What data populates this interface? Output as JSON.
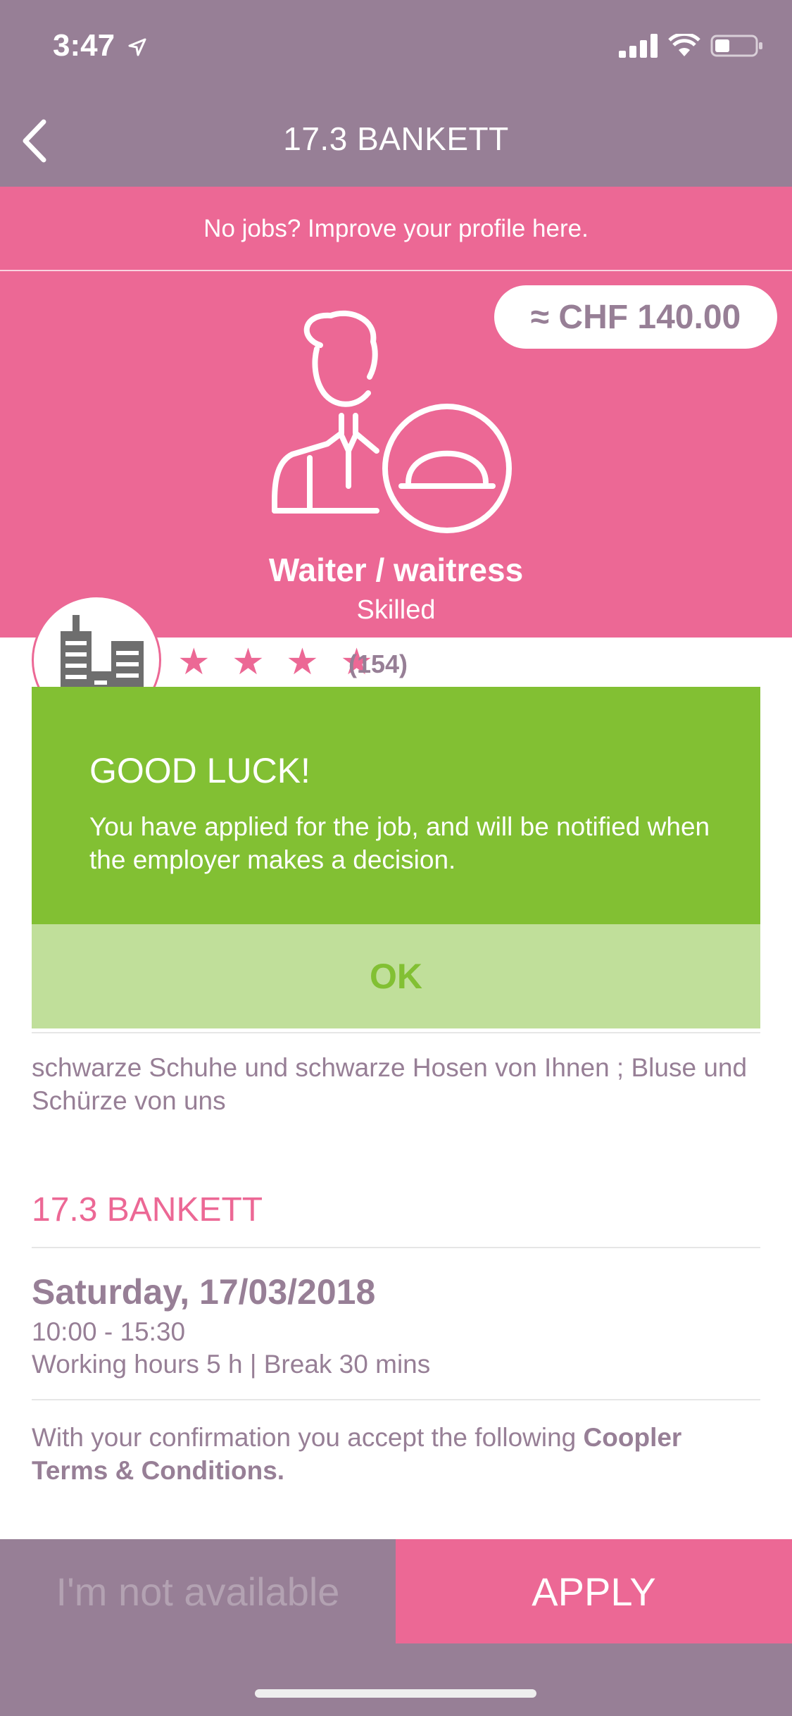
{
  "status_bar": {
    "time": "3:47",
    "icons": [
      "location-arrow-icon",
      "signal-icon",
      "wifi-icon",
      "battery-icon"
    ]
  },
  "nav": {
    "title": "17.3 BANKETT",
    "back_icon": "chevron-left-icon"
  },
  "banner": {
    "text": "No jobs? Improve your profile here."
  },
  "hero": {
    "price": "≈ CHF 140.00",
    "job_title": "Waiter / waitress",
    "job_level": "Skilled"
  },
  "company": {
    "rating_stars": 4,
    "rating_count": "(154)",
    "stars_text": "★ ★ ★ ★"
  },
  "dialog": {
    "title": "GOOD LUCK!",
    "message": "You have applied for the job, and will be notified when the employer makes a decision.",
    "ok_label": "OK"
  },
  "details": {
    "description": "schwarze Schuhe und schwarze Hosen von Ihnen ; Bluse und Schürze von uns",
    "section_title": "17.3 BANKETT",
    "date": "Saturday, 17/03/2018",
    "time_range": "10:00 - 15:30",
    "hours": "Working hours 5 h |  Break 30 mins",
    "terms_prefix": "With your confirmation you accept the following ",
    "terms_link": "Coopler Terms & Conditions."
  },
  "actions": {
    "not_available_label": "I'm not available",
    "apply_label": "APPLY"
  },
  "colors": {
    "purple": "#977f96",
    "pink": "#ec6895",
    "green": "#82c033",
    "light_green": "#c0df9a"
  }
}
